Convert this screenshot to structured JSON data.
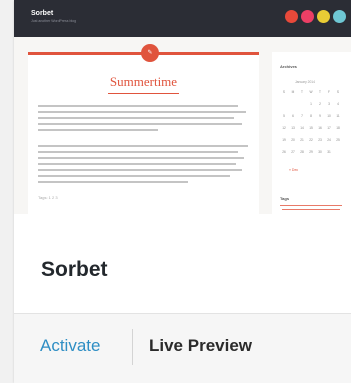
{
  "preview": {
    "site_title": "Sorbet",
    "site_tagline": "Just another WordPress blog",
    "header_dots": [
      {
        "name": "red",
        "color": "#e8493a"
      },
      {
        "name": "pink",
        "color": "#ec3f65"
      },
      {
        "name": "yellow",
        "color": "#e9cc35"
      },
      {
        "name": "teal",
        "color": "#6ec7d4"
      }
    ],
    "post": {
      "title": "Summertime",
      "meta": "Tags: 1 2 3"
    },
    "sidebar": {
      "archives_heading": "Archives",
      "calendar_caption": "January 2014",
      "weekday_labels": [
        "S",
        "M",
        "T",
        "W",
        "T",
        "F",
        "S"
      ],
      "day_rows": [
        [
          "",
          "",
          "",
          "1",
          "2",
          "3",
          "4"
        ],
        [
          "5",
          "6",
          "7",
          "8",
          "9",
          "10",
          "11"
        ],
        [
          "12",
          "13",
          "14",
          "15",
          "16",
          "17",
          "18"
        ],
        [
          "19",
          "20",
          "21",
          "22",
          "23",
          "24",
          "25"
        ],
        [
          "26",
          "27",
          "28",
          "29",
          "30",
          "31",
          ""
        ]
      ],
      "prev_link": "« Dec",
      "tags_heading": "Tags"
    }
  },
  "theme": {
    "name": "Sorbet",
    "activate_label": "Activate",
    "live_preview_label": "Live Preview"
  },
  "colors": {
    "accent": "#e0543d",
    "header_bg": "#2b2d35",
    "activate_link": "#2e8ec4"
  }
}
